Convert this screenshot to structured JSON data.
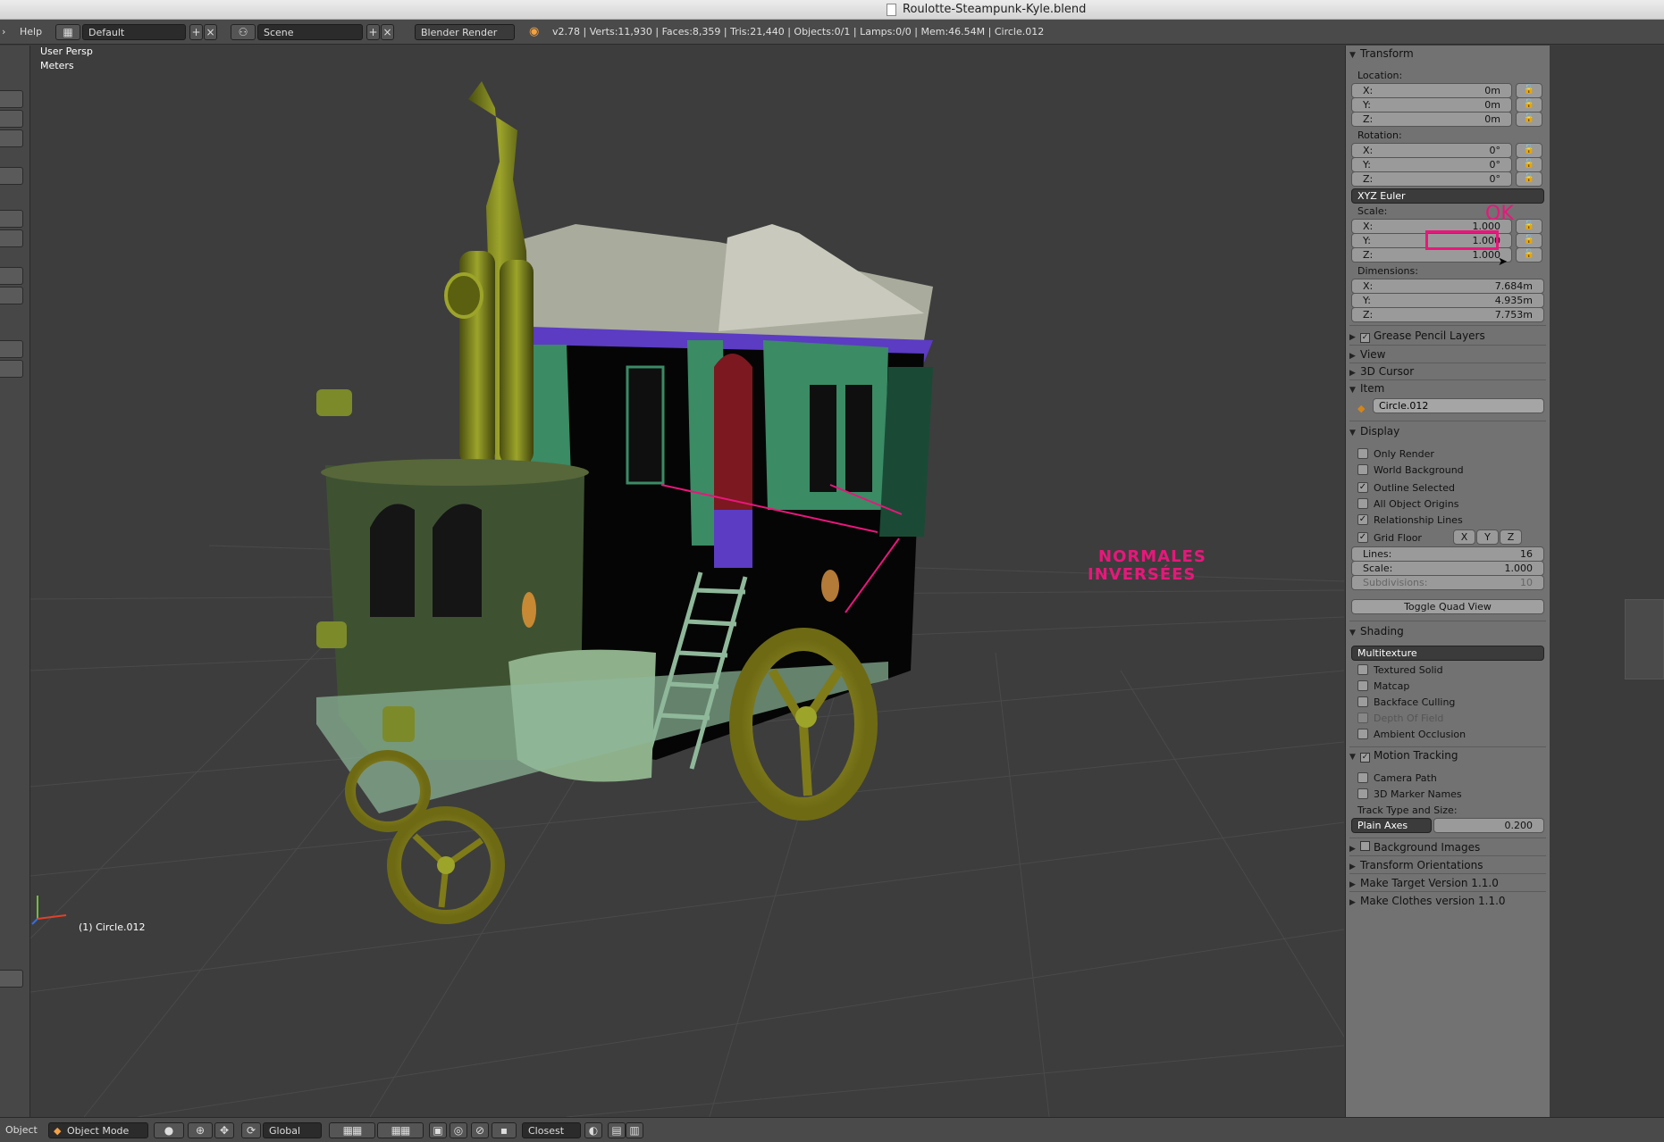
{
  "window": {
    "title": "Roulotte-Steampunk-Kyle.blend"
  },
  "infobar": {
    "help": "Help",
    "screen_layout": "Default",
    "scene": "Scene",
    "render_engine": "Blender Render",
    "stats": "v2.78 | Verts:11,930 | Faces:8,359 | Tris:21,440 | Objects:0/1 | Lamps:0/0 | Mem:46.54M | Circle.012"
  },
  "viewport": {
    "view_name": "User Persp",
    "units": "Meters",
    "object_label": "(1) Circle.012"
  },
  "annotations": {
    "ok": "OK",
    "normales_line1": "NORMALES",
    "normales_line2": "INVERSÉES"
  },
  "panel": {
    "transform": {
      "title": "Transform",
      "location_label": "Location:",
      "location": [
        {
          "axis": "X:",
          "value": "0m"
        },
        {
          "axis": "Y:",
          "value": "0m"
        },
        {
          "axis": "Z:",
          "value": "0m"
        }
      ],
      "rotation_label": "Rotation:",
      "rotation": [
        {
          "axis": "X:",
          "value": "0°"
        },
        {
          "axis": "Y:",
          "value": "0°"
        },
        {
          "axis": "Z:",
          "value": "0°"
        }
      ],
      "rotation_mode": "XYZ Euler",
      "scale_label": "Scale:",
      "scale": [
        {
          "axis": "X:",
          "value": "1.000"
        },
        {
          "axis": "Y:",
          "value": "1.000"
        },
        {
          "axis": "Z:",
          "value": "1.000"
        }
      ],
      "dimensions_label": "Dimensions:",
      "dimensions": [
        {
          "axis": "X:",
          "value": "7.684m"
        },
        {
          "axis": "Y:",
          "value": "4.935m"
        },
        {
          "axis": "Z:",
          "value": "7.753m"
        }
      ]
    },
    "grease_pencil": "Grease Pencil Layers",
    "view": "View",
    "cursor": "3D Cursor",
    "item": {
      "title": "Item",
      "name": "Circle.012"
    },
    "display": {
      "title": "Display",
      "only_render": "Only Render",
      "world_background": "World Background",
      "outline_selected": "Outline Selected",
      "all_object_origins": "All Object Origins",
      "relationship_lines": "Relationship Lines",
      "grid_floor": "Grid Floor",
      "axis_x": "X",
      "axis_y": "Y",
      "axis_z": "Z",
      "lines_label": "Lines:",
      "lines": "16",
      "scale_label": "Scale:",
      "scale": "1.000",
      "subdivisions_label": "Subdivisions:",
      "subdivisions": "10",
      "toggle_quad": "Toggle Quad View"
    },
    "shading": {
      "title": "Shading",
      "mode": "Multitexture",
      "textured_solid": "Textured Solid",
      "matcap": "Matcap",
      "backface_culling": "Backface Culling",
      "depth_of_field": "Depth Of Field",
      "ambient_occlusion": "Ambient Occlusion"
    },
    "motion_tracking": {
      "title": "Motion Tracking",
      "camera_path": "Camera Path",
      "marker_names": "3D Marker Names",
      "track_label": "Track Type and Size:",
      "track_type": "Plain Axes",
      "track_size": "0.200"
    },
    "background_images": "Background Images",
    "transform_orientations": "Transform Orientations",
    "make_target": "Make Target  Version 1.1.0",
    "make_clothes": "Make Clothes version 1.1.0"
  },
  "statusbar": {
    "object_menu": "Object",
    "mode": "Object Mode",
    "orientation": "Global",
    "snap": "Closest"
  }
}
